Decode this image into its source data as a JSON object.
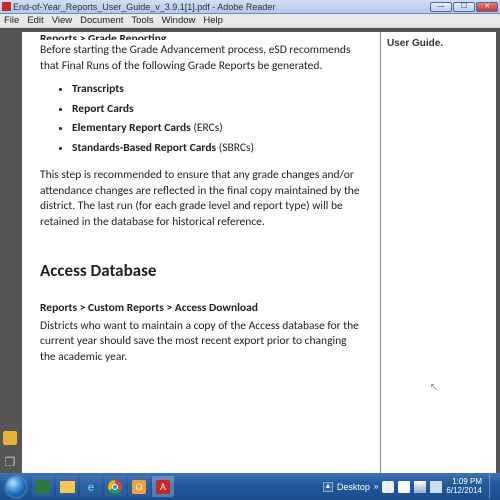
{
  "window": {
    "title": "End-of-Year_Reports_User_Guide_v_3.9.1[1].pdf - Adobe Reader"
  },
  "menu": {
    "file": "File",
    "edit": "Edit",
    "view": "View",
    "document": "Document",
    "tools": "Tools",
    "window": "Window",
    "help": "Help"
  },
  "doc": {
    "breadcrumb_top": "Reports > Grade Reporting",
    "intro1": "Before starting the Grade Advancement process, eSD recommends that Final Runs of the following Grade Reports be generated.",
    "bullets": {
      "b1": "Transcripts",
      "b2": "Report Cards",
      "b3": "Elementary Report Cards",
      "b3s": " (ERCs)",
      "b4": "Standards-Based Report Cards",
      "b4s": " (SBRCs)"
    },
    "para2": "This step is recommended to ensure that any grade changes and/or attendance changes are reflected in the final copy maintained by the district. The last run (for each grade level and report type) will be retained in the database for historical reference.",
    "h2": "Access Database",
    "breadcrumb2": "Reports > Custom Reports > Access Download",
    "para3": "Districts who want to maintain a copy of the Access database for the current year should save the most recent export prior to changing the academic year."
  },
  "sidepanel": {
    "text": "User Guide."
  },
  "taskbar": {
    "desktop": "Desktop",
    "time": "1:09 PM",
    "date": "6/12/2014"
  }
}
